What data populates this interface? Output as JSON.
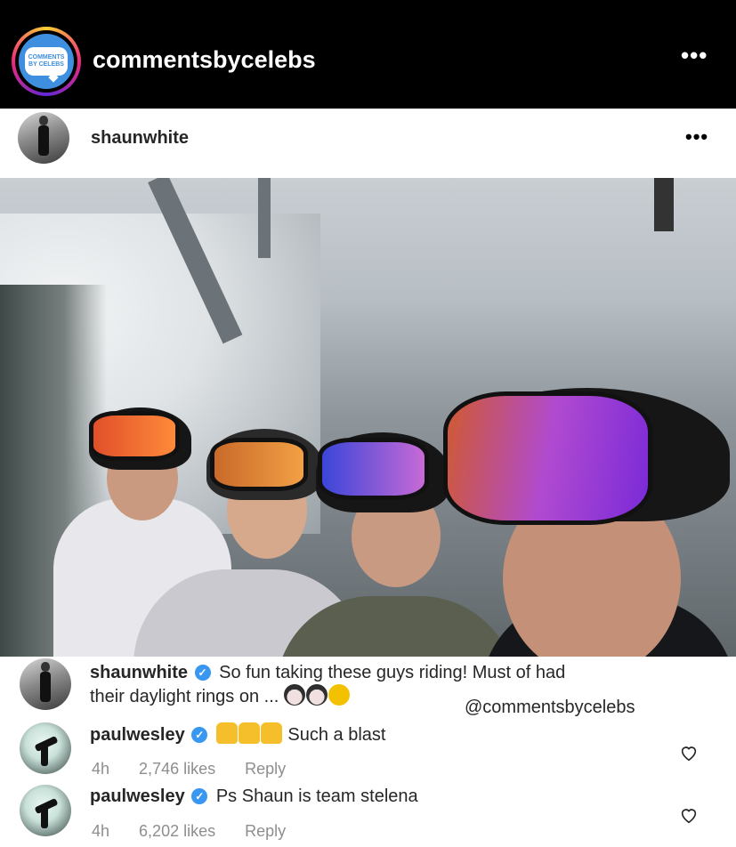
{
  "header": {
    "account": "commentsbycelebs",
    "logo_line1": "COMMENTS",
    "logo_line2": "BY CELEBS",
    "more_icon": "more-dots-icon"
  },
  "post": {
    "username": "shaunwhite",
    "more_icon": "more-dots-icon",
    "photo_subject": "ski-lift-selfie-image"
  },
  "comments": [
    {
      "username": "shaunwhite",
      "verified": true,
      "text_line1": "So fun taking these guys riding! Must of had",
      "text_line2": "their daylight rings on ..."
    },
    {
      "username": "paulwesley",
      "verified": true,
      "text": "Such a blast",
      "time": "4h",
      "likes": "2,746 likes",
      "reply": "Reply"
    },
    {
      "username": "paulwesley",
      "verified": true,
      "text": "Ps Shaun is team stelena",
      "time": "4h",
      "likes": "6,202 likes",
      "reply": "Reply"
    }
  ],
  "watermark": "@commentsbycelebs",
  "colors": {
    "verified": "#3897f0",
    "topbar": "#000000",
    "meta": "#8e8e8e"
  }
}
